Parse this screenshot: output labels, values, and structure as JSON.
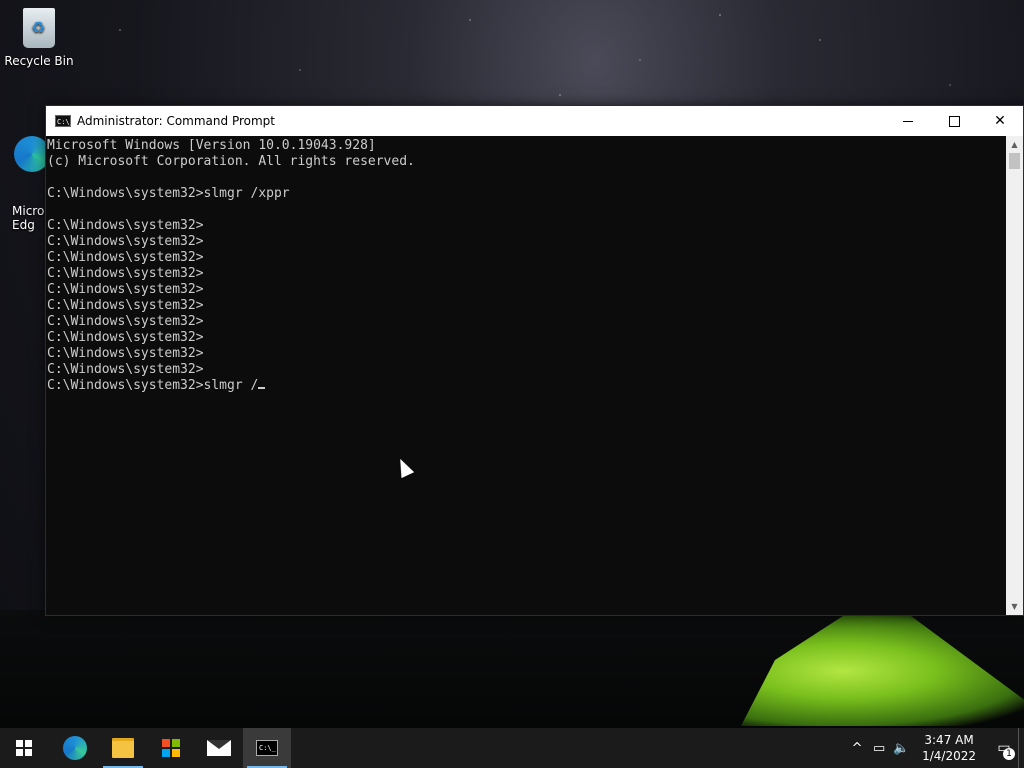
{
  "desktop": {
    "icons": [
      {
        "label": "Recycle Bin"
      },
      {
        "label": "Micro\nEdg"
      }
    ]
  },
  "window": {
    "title": "Administrator: Command Prompt",
    "icon_text": "C:\\_",
    "controls": {
      "minimize": "minimize",
      "maximize": "maximize",
      "close": "✕"
    }
  },
  "console": {
    "lines": [
      "Microsoft Windows [Version 10.0.19043.928]",
      "(c) Microsoft Corporation. All rights reserved.",
      "",
      "C:\\Windows\\system32>slmgr /xppr",
      "",
      "C:\\Windows\\system32>",
      "C:\\Windows\\system32>",
      "C:\\Windows\\system32>",
      "C:\\Windows\\system32>",
      "C:\\Windows\\system32>",
      "C:\\Windows\\system32>",
      "C:\\Windows\\system32>",
      "C:\\Windows\\system32>",
      "C:\\Windows\\system32>",
      "C:\\Windows\\system32>",
      "C:\\Windows\\system32>slmgr /"
    ]
  },
  "taskbar": {
    "apps": [
      {
        "name": "start-button",
        "running": false
      },
      {
        "name": "edge",
        "running": false
      },
      {
        "name": "file-explorer",
        "running": true
      },
      {
        "name": "microsoft-store",
        "running": false
      },
      {
        "name": "mail",
        "running": false
      },
      {
        "name": "command-prompt",
        "running": true,
        "active": true
      }
    ],
    "tray": {
      "chevron": "^",
      "time": "3:47 AM",
      "date": "1/4/2022",
      "notification_count": "1"
    }
  },
  "colors": {
    "console_bg": "#0c0c0c",
    "console_fg": "#cccccc",
    "taskbar_bg": "#1b1b1b",
    "accent": "#76b9ed"
  }
}
